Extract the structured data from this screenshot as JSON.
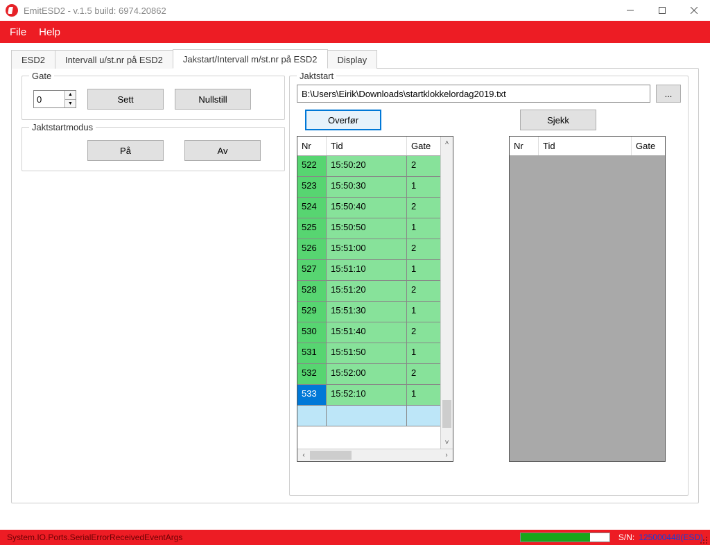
{
  "window": {
    "title": "EmitESD2  - v.1.5   build: 6974.20862"
  },
  "menu": {
    "file": "File",
    "help": "Help"
  },
  "tabs": {
    "esd2": "ESD2",
    "intervall_u": "Intervall u/st.nr på ESD2",
    "jakstart": "Jakstart/Intervall m/st.nr på ESD2",
    "display": "Display"
  },
  "gate": {
    "legend": "Gate",
    "value": "0",
    "sett": "Sett",
    "nullstill": "Nullstill"
  },
  "modus": {
    "legend": "Jaktstartmodus",
    "pa": "På",
    "av": "Av"
  },
  "jakt": {
    "legend": "Jaktstart",
    "path": "B:\\Users\\Eirik\\Downloads\\startklokkelordag2019.txt",
    "browse": "...",
    "overfor": "Overfør",
    "sjekk": "Sjekk",
    "cols": {
      "nr": "Nr",
      "tid": "Tid",
      "gate": "Gate"
    },
    "rows": [
      {
        "nr": "522",
        "tid": "15:50:20",
        "gate": "2"
      },
      {
        "nr": "523",
        "tid": "15:50:30",
        "gate": "1"
      },
      {
        "nr": "524",
        "tid": "15:50:40",
        "gate": "2"
      },
      {
        "nr": "525",
        "tid": "15:50:50",
        "gate": "1"
      },
      {
        "nr": "526",
        "tid": "15:51:00",
        "gate": "2"
      },
      {
        "nr": "527",
        "tid": "15:51:10",
        "gate": "1"
      },
      {
        "nr": "528",
        "tid": "15:51:20",
        "gate": "2"
      },
      {
        "nr": "529",
        "tid": "15:51:30",
        "gate": "1"
      },
      {
        "nr": "530",
        "tid": "15:51:40",
        "gate": "2"
      },
      {
        "nr": "531",
        "tid": "15:51:50",
        "gate": "1"
      },
      {
        "nr": "532",
        "tid": "15:52:00",
        "gate": "2"
      },
      {
        "nr": "533",
        "tid": "15:52:10",
        "gate": "1"
      }
    ]
  },
  "status": {
    "error": "System.IO.Ports.SerialErrorReceivedEventArgs",
    "sn_label": "S/N:",
    "sn_value": "125000448(ESD)"
  }
}
